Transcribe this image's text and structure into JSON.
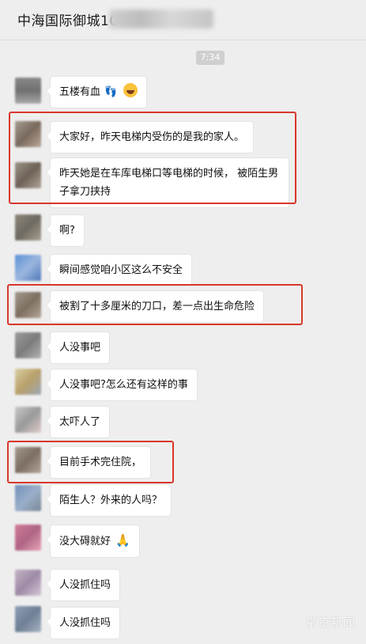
{
  "header": {
    "title": "中海国际御城10"
  },
  "timestamp": "7:34",
  "messages": [
    {
      "text": "五楼有血",
      "trail": [
        "feet-icon",
        "laughing-tears-icon"
      ]
    },
    {
      "text": "大家好，昨天电梯内受伤的是我的家人。"
    },
    {
      "text": "昨天她是在车库电梯口等电梯的时候， 被陌生男子拿刀挟持"
    },
    {
      "text": "啊?"
    },
    {
      "text": "瞬间感觉咱小区这么不安全"
    },
    {
      "text": "被割了十多厘米的刀口，差一点出生命危险"
    },
    {
      "text": "人没事吧"
    },
    {
      "text": "人没事吧?怎么还有这样的事"
    },
    {
      "text": "太吓人了"
    },
    {
      "text": "目前手术完住院，"
    },
    {
      "text": "陌生人？外来的人吗？"
    },
    {
      "text": "没大碍就好",
      "trail": [
        "praying-hands-icon"
      ]
    },
    {
      "text": "人没抓住吗"
    },
    {
      "text": "人没抓住吗"
    }
  ],
  "watermark": "掌资新闻",
  "colors": {
    "highlight": "#d9372c",
    "background": "#eeeeee",
    "bubble": "#ffffff"
  }
}
